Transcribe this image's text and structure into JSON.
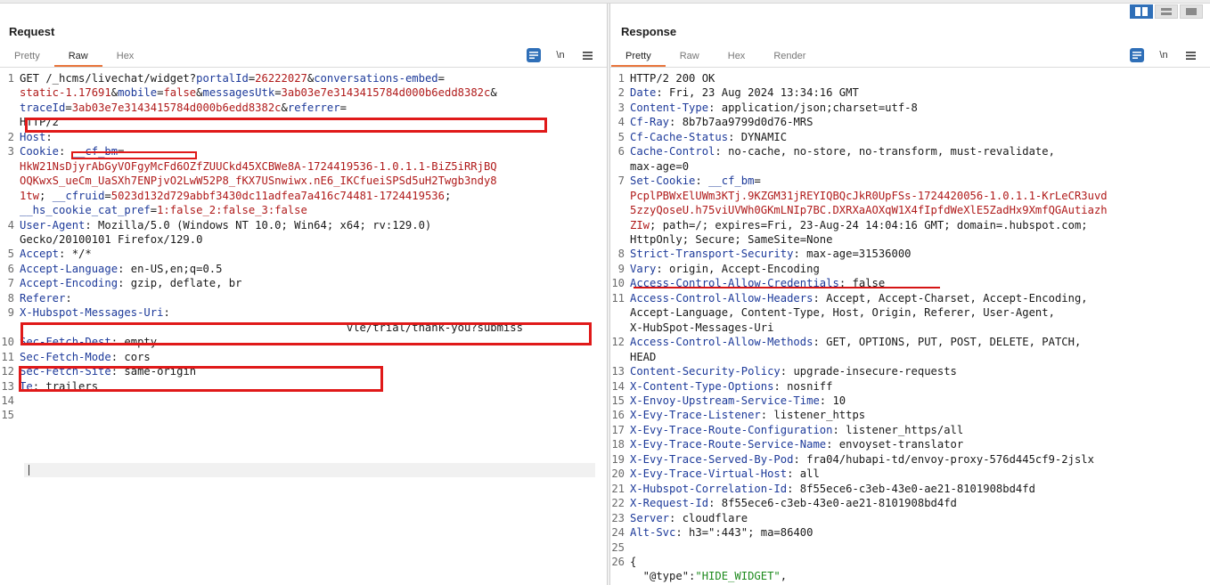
{
  "request": {
    "title": "Request",
    "tabs": [
      "Pretty",
      "Raw",
      "Hex"
    ],
    "active_tab": "Raw",
    "tools": {
      "newline_label": "\\n"
    },
    "lines": [
      {
        "n": "1",
        "parts": [
          [
            "GET /_hcms/livechat/widget?",
            "hv"
          ],
          [
            "portalId",
            "h"
          ],
          [
            "=",
            "hv"
          ],
          [
            "26222027",
            "r"
          ],
          [
            "&",
            "hv"
          ],
          [
            "conversations-embed",
            "h"
          ],
          [
            "=",
            "hv"
          ]
        ]
      },
      {
        "n": "",
        "parts": [
          [
            "static-1.17691",
            "r"
          ],
          [
            "&",
            "hv"
          ],
          [
            "mobile",
            "h"
          ],
          [
            "=",
            "hv"
          ],
          [
            "false",
            "r"
          ],
          [
            "&",
            "hv"
          ],
          [
            "messagesUtk",
            "h"
          ],
          [
            "=",
            "hv"
          ],
          [
            "3ab03e7e3143415784d000b6edd8382c",
            "r"
          ],
          [
            "&",
            "hv"
          ]
        ]
      },
      {
        "n": "",
        "parts": [
          [
            "traceId",
            "h"
          ],
          [
            "=",
            "hv"
          ],
          [
            "3ab03e7e3143415784d000b6edd8382c",
            "r"
          ],
          [
            "&",
            "hv"
          ],
          [
            "referrer",
            "h"
          ],
          [
            "=",
            "hv"
          ]
        ]
      },
      {
        "n": "",
        "parts": [
          [
            "",
            "hv"
          ]
        ]
      },
      {
        "n": "",
        "parts": [
          [
            "HTTP/2",
            "hv"
          ]
        ]
      },
      {
        "n": "2",
        "parts": [
          [
            "Host",
            "h"
          ],
          [
            ": ",
            "hv"
          ]
        ]
      },
      {
        "n": "3",
        "parts": [
          [
            "Cookie",
            "h"
          ],
          [
            ": ",
            "hv"
          ],
          [
            "__cf_bm",
            "h"
          ],
          [
            "=",
            "hv"
          ]
        ]
      },
      {
        "n": "",
        "parts": [
          [
            "HkW21NsDjyrAbGyVOFgyMcFd6OZfZUUCkd45XCBWe8A-1724419536-1.0.1.1-BiZ5iRRjBQ",
            "r"
          ]
        ]
      },
      {
        "n": "",
        "parts": [
          [
            "OQKwxS_ueCm_UaSXh7ENPjvO2LwW52P8_fKX7USnwiwx.nE6_IKCfueiSPSd5uH2Twgb3ndy8",
            "r"
          ]
        ]
      },
      {
        "n": "",
        "parts": [
          [
            "1tw",
            "r"
          ],
          [
            "; ",
            "hv"
          ],
          [
            "__cfruid",
            "h"
          ],
          [
            "=",
            "hv"
          ],
          [
            "5023d132d729abbf3430dc11adfea7a416c74481-1724419536",
            "r"
          ],
          [
            ";",
            "hv"
          ]
        ]
      },
      {
        "n": "",
        "parts": [
          [
            "__hs_cookie_cat_pref",
            "h"
          ],
          [
            "=",
            "hv"
          ],
          [
            "1:false_2:false_3:false",
            "r"
          ]
        ]
      },
      {
        "n": "4",
        "parts": [
          [
            "User-Agent",
            "h"
          ],
          [
            ": Mozilla/5.0 (Windows NT 10.0; Win64; x64; rv:129.0)",
            "hv"
          ]
        ]
      },
      {
        "n": "",
        "parts": [
          [
            "Gecko/20100101 Firefox/129.0",
            "hv"
          ]
        ]
      },
      {
        "n": "5",
        "parts": [
          [
            "Accept",
            "h"
          ],
          [
            ": */*",
            "hv"
          ]
        ]
      },
      {
        "n": "6",
        "parts": [
          [
            "Accept-Language",
            "h"
          ],
          [
            ": en-US,en;q=0.5",
            "hv"
          ]
        ]
      },
      {
        "n": "7",
        "parts": [
          [
            "Accept-Encoding",
            "h"
          ],
          [
            ": gzip, deflate, br",
            "hv"
          ]
        ]
      },
      {
        "n": "8",
        "parts": [
          [
            "Referer",
            "h"
          ],
          [
            ":",
            "hv"
          ]
        ]
      },
      {
        "n": "",
        "parts": [
          [
            "",
            "hv"
          ]
        ]
      },
      {
        "n": "",
        "parts": [
          [
            "",
            "hv"
          ]
        ]
      },
      {
        "n": "9",
        "parts": [
          [
            "X-Hubspot-Messages-Uri",
            "h"
          ],
          [
            ":",
            "hv"
          ]
        ]
      },
      {
        "n": "",
        "parts": [
          [
            "                                                  vle/trial/thank-you?submiss",
            "hv"
          ]
        ]
      },
      {
        "n": "",
        "parts": [
          [
            "",
            "hv"
          ]
        ]
      },
      {
        "n": "10",
        "parts": [
          [
            "Sec-Fetch-Dest",
            "h"
          ],
          [
            ": empty",
            "hv"
          ]
        ]
      },
      {
        "n": "11",
        "parts": [
          [
            "Sec-Fetch-Mode",
            "h"
          ],
          [
            ": cors",
            "hv"
          ]
        ]
      },
      {
        "n": "12",
        "parts": [
          [
            "Sec-Fetch-Site",
            "h"
          ],
          [
            ": same-origin",
            "hv"
          ]
        ]
      },
      {
        "n": "13",
        "parts": [
          [
            "Te",
            "h"
          ],
          [
            ": trailers",
            "hv"
          ]
        ]
      },
      {
        "n": "14",
        "parts": [
          [
            "",
            "hv"
          ]
        ]
      },
      {
        "n": "15",
        "parts": [
          [
            "",
            "hv"
          ]
        ]
      }
    ]
  },
  "response": {
    "title": "Response",
    "tabs": [
      "Pretty",
      "Raw",
      "Hex",
      "Render"
    ],
    "active_tab": "Pretty",
    "tools": {
      "newline_label": "\\n"
    },
    "lines": [
      {
        "n": "1",
        "parts": [
          [
            "HTTP/2 200 OK",
            "hv"
          ]
        ]
      },
      {
        "n": "2",
        "parts": [
          [
            "Date",
            "h"
          ],
          [
            ": Fri, 23 Aug 2024 13:34:16 GMT",
            "hv"
          ]
        ]
      },
      {
        "n": "3",
        "parts": [
          [
            "Content-Type",
            "h"
          ],
          [
            ": application/json;charset=utf-8",
            "hv"
          ]
        ]
      },
      {
        "n": "4",
        "parts": [
          [
            "Cf-Ray",
            "h"
          ],
          [
            ": 8b7b7aa9799d0d76-MRS",
            "hv"
          ]
        ]
      },
      {
        "n": "5",
        "parts": [
          [
            "Cf-Cache-Status",
            "h"
          ],
          [
            ": DYNAMIC",
            "hv"
          ]
        ]
      },
      {
        "n": "6",
        "parts": [
          [
            "Cache-Control",
            "h"
          ],
          [
            ": no-cache, no-store, no-transform, must-revalidate,",
            "hv"
          ]
        ]
      },
      {
        "n": "",
        "parts": [
          [
            "max-age=0",
            "hv"
          ]
        ]
      },
      {
        "n": "7",
        "parts": [
          [
            "Set-Cookie",
            "h"
          ],
          [
            ": ",
            "hv"
          ],
          [
            "__cf_bm",
            "h"
          ],
          [
            "=",
            "hv"
          ]
        ]
      },
      {
        "n": "",
        "parts": [
          [
            "PcplPBWxElUWm3KTj.9KZGM31jREYIQBQcJkR0UpFSs-1724420056-1.0.1.1-KrLeCR3uvd",
            "r"
          ]
        ]
      },
      {
        "n": "",
        "parts": [
          [
            "5zzyQoseU.h75viUVWh0GKmLNIp7BC.DXRXaAOXqW1X4fIpfdWeXlE5ZadHx9XmfQGAutiazh",
            "r"
          ]
        ]
      },
      {
        "n": "",
        "parts": [
          [
            "ZIw",
            "r"
          ],
          [
            "; path=/; expires=Fri, 23-Aug-24 14:04:16 GMT; domain=.hubspot.com;",
            "hv"
          ]
        ]
      },
      {
        "n": "",
        "parts": [
          [
            "HttpOnly; Secure; SameSite=None",
            "hv"
          ]
        ]
      },
      {
        "n": "8",
        "parts": [
          [
            "Strict-Transport-Security",
            "h"
          ],
          [
            ": max-age=31536000",
            "hv"
          ]
        ]
      },
      {
        "n": "9",
        "parts": [
          [
            "Vary",
            "h"
          ],
          [
            ": origin, Accept-Encoding",
            "hv"
          ]
        ]
      },
      {
        "n": "10",
        "parts": [
          [
            "Access-Control-Allow-Credentials",
            "h"
          ],
          [
            ": false",
            "hv"
          ]
        ]
      },
      {
        "n": "11",
        "parts": [
          [
            "Access-Control-Allow-Headers",
            "h"
          ],
          [
            ": Accept, Accept-Charset, Accept-Encoding,",
            "hv"
          ]
        ]
      },
      {
        "n": "",
        "parts": [
          [
            "Accept-Language, Content-Type, Host, Origin, Referer, User-Agent,",
            "hv"
          ]
        ]
      },
      {
        "n": "",
        "parts": [
          [
            "X-HubSpot-Messages-Uri",
            "hv"
          ]
        ]
      },
      {
        "n": "12",
        "parts": [
          [
            "Access-Control-Allow-Methods",
            "h"
          ],
          [
            ": GET, OPTIONS, PUT, POST, DELETE, PATCH,",
            "hv"
          ]
        ]
      },
      {
        "n": "",
        "parts": [
          [
            "HEAD",
            "hv"
          ]
        ]
      },
      {
        "n": "13",
        "parts": [
          [
            "Content-Security-Policy",
            "h"
          ],
          [
            ": upgrade-insecure-requests",
            "hv"
          ]
        ]
      },
      {
        "n": "14",
        "parts": [
          [
            "X-Content-Type-Options",
            "h"
          ],
          [
            ": nosniff",
            "hv"
          ]
        ]
      },
      {
        "n": "15",
        "parts": [
          [
            "X-Envoy-Upstream-Service-Time",
            "h"
          ],
          [
            ": 10",
            "hv"
          ]
        ]
      },
      {
        "n": "16",
        "parts": [
          [
            "X-Evy-Trace-Listener",
            "h"
          ],
          [
            ": listener_https",
            "hv"
          ]
        ]
      },
      {
        "n": "17",
        "parts": [
          [
            "X-Evy-Trace-Route-Configuration",
            "h"
          ],
          [
            ": listener_https/all",
            "hv"
          ]
        ]
      },
      {
        "n": "18",
        "parts": [
          [
            "X-Evy-Trace-Route-Service-Name",
            "h"
          ],
          [
            ": envoyset-translator",
            "hv"
          ]
        ]
      },
      {
        "n": "19",
        "parts": [
          [
            "X-Evy-Trace-Served-By-Pod",
            "h"
          ],
          [
            ": fra04/hubapi-td/envoy-proxy-576d445cf9-2jslx",
            "hv"
          ]
        ]
      },
      {
        "n": "20",
        "parts": [
          [
            "X-Evy-Trace-Virtual-Host",
            "h"
          ],
          [
            ": all",
            "hv"
          ]
        ]
      },
      {
        "n": "21",
        "parts": [
          [
            "X-Hubspot-Correlation-Id",
            "h"
          ],
          [
            ": 8f55ece6-c3eb-43e0-ae21-8101908bd4fd",
            "hv"
          ]
        ]
      },
      {
        "n": "22",
        "parts": [
          [
            "X-Request-Id",
            "h"
          ],
          [
            ": 8f55ece6-c3eb-43e0-ae21-8101908bd4fd",
            "hv"
          ]
        ]
      },
      {
        "n": "23",
        "parts": [
          [
            "Server",
            "h"
          ],
          [
            ": cloudflare",
            "hv"
          ]
        ]
      },
      {
        "n": "24",
        "parts": [
          [
            "Alt-Svc",
            "h"
          ],
          [
            ": h3=\":443\"; ma=86400",
            "hv"
          ]
        ]
      },
      {
        "n": "25",
        "parts": [
          [
            "",
            "hv"
          ]
        ]
      },
      {
        "n": "26",
        "parts": [
          [
            "{",
            "hv"
          ]
        ]
      },
      {
        "n": "",
        "parts": [
          [
            "  \"@type\":",
            "hv"
          ],
          [
            "\"HIDE_WIDGET\"",
            "str"
          ],
          [
            ",",
            "hv"
          ]
        ]
      }
    ]
  },
  "colors": {
    "accent_tab": "#e8743b",
    "header_blue": "#1d3a9a",
    "value_red": "#b01b1b",
    "redaction": "#e01919",
    "toggle_blue": "#2f6fb8"
  }
}
